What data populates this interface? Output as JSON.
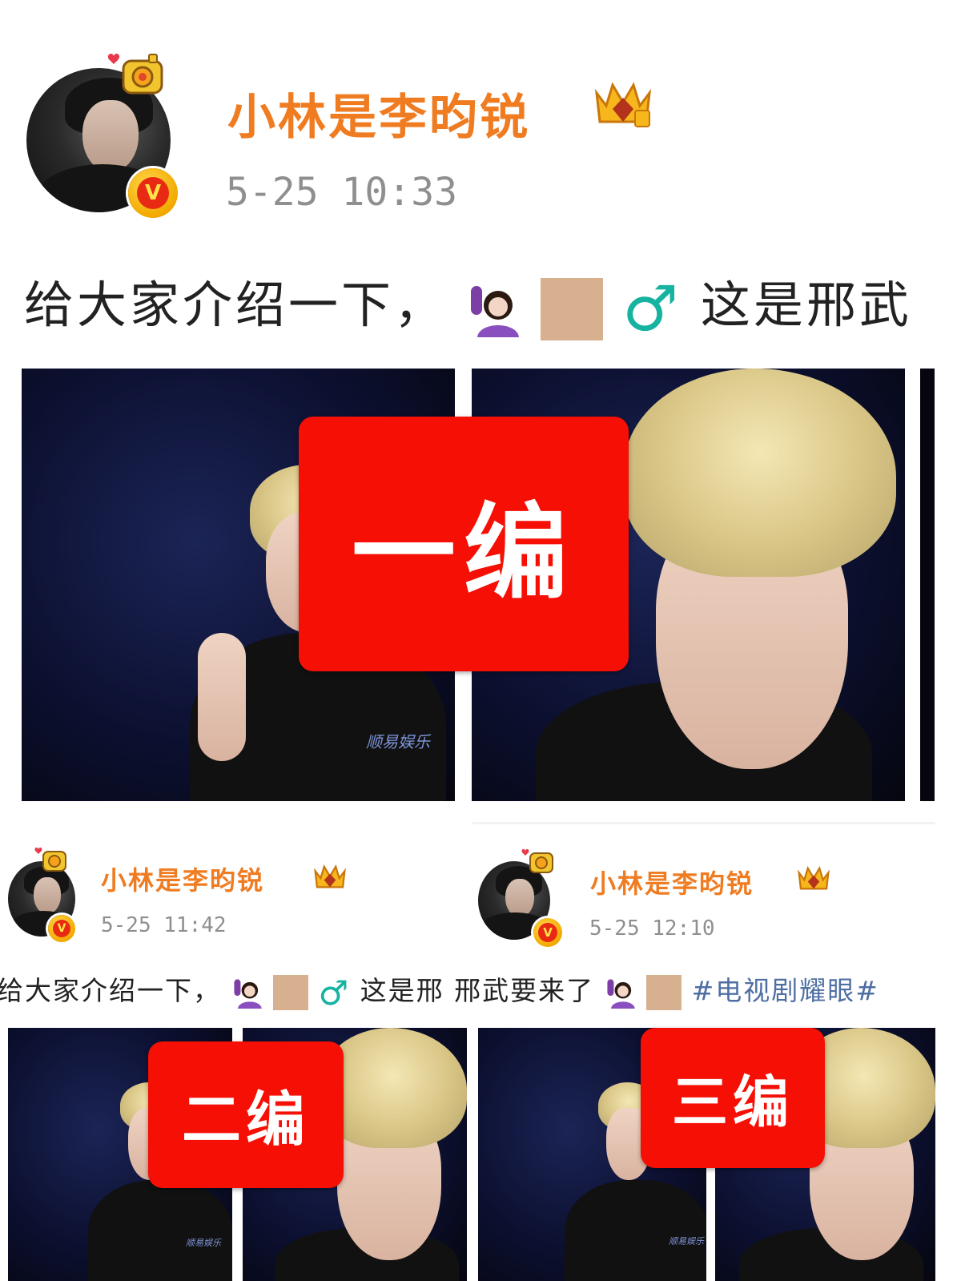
{
  "post_main": {
    "username": "小林是李昀锐",
    "timestamp": "5-25 10:33",
    "text": "给大家介绍一下，",
    "text_after": "这是邢武",
    "male_symbol": "♂",
    "stamp_label": "一编"
  },
  "post_second": {
    "username": "小林是李昀锐",
    "timestamp": "5-25 11:42",
    "stamp_label": "二编"
  },
  "post_third": {
    "username": "小林是李昀锐",
    "timestamp": "5-25 12:10",
    "stamp_label": "三编"
  },
  "shared_text": {
    "prefix": "给大家介绍一下，",
    "middle": "这是邢 邢武要来了",
    "hashtag": "#电视剧耀眼#",
    "male_symbol": "♂"
  },
  "photo_logo": "顺易娱乐",
  "badge_letter": "V",
  "colors": {
    "username": "#f07c22",
    "stamp": "#f50f05",
    "hashtag": "#4f6fa3",
    "male_symbol": "#16b3a0",
    "timestamp": "#8f8f8f"
  },
  "icons": [
    "avatar-frame-camera-icon",
    "verified-v-badge-icon",
    "crown-badge-icon",
    "woman-raising-hand-icon",
    "skin-tone-icon",
    "male-sign-icon"
  ]
}
